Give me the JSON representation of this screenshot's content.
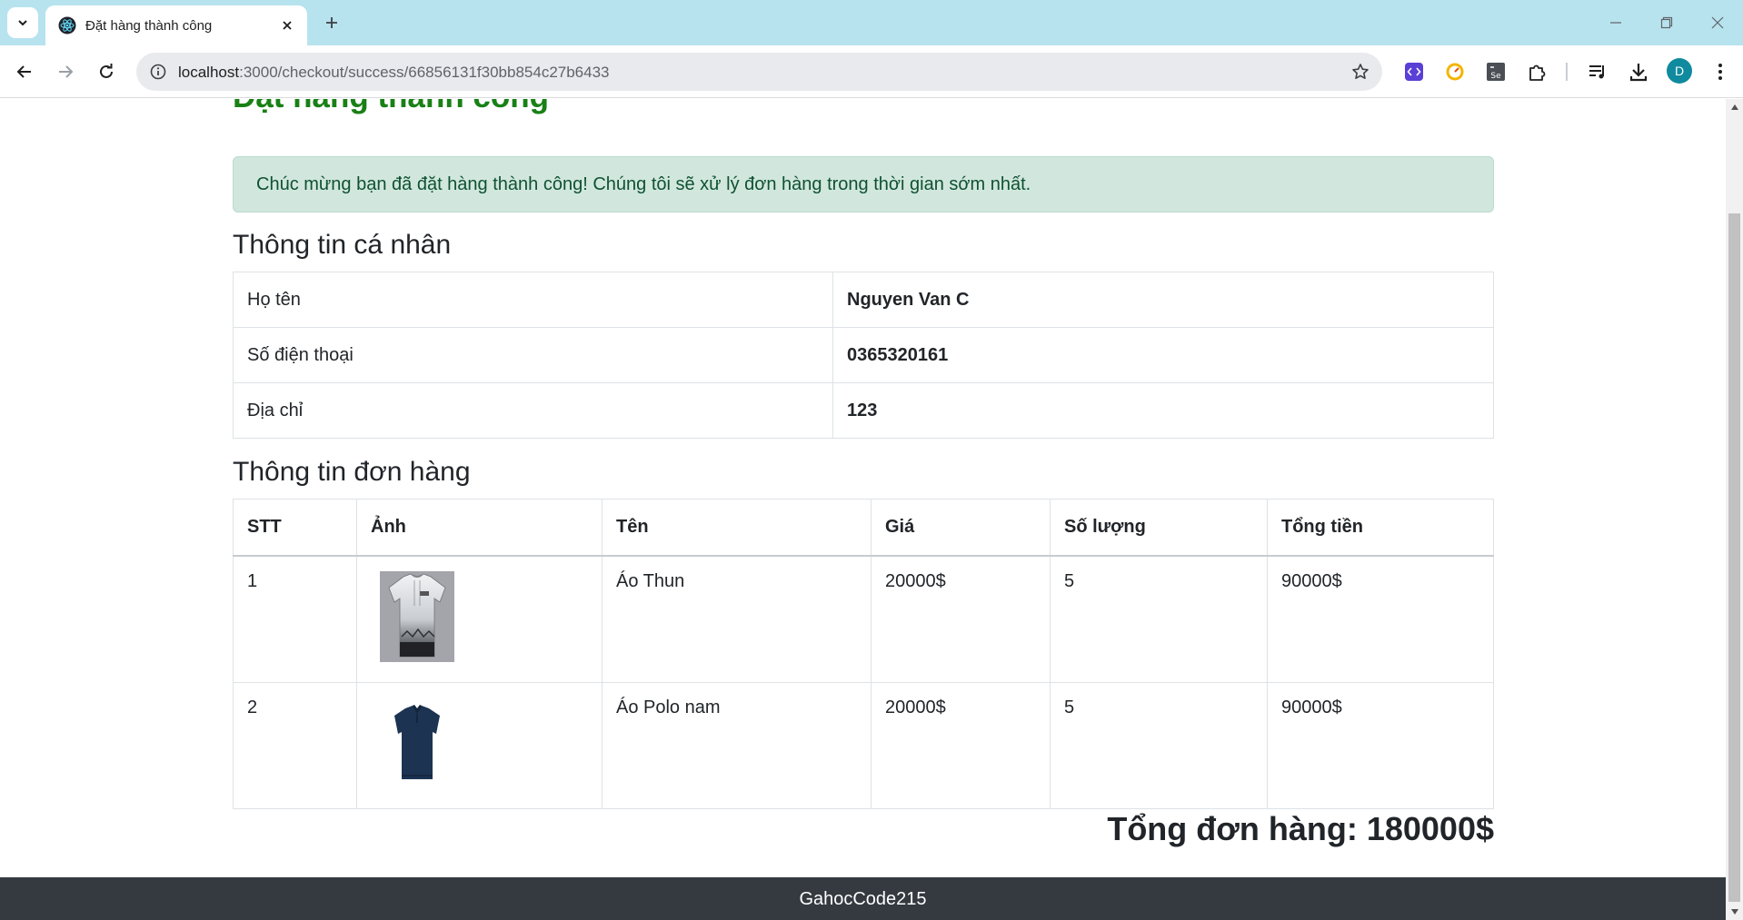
{
  "browser": {
    "tab_title": "Đặt hàng thành công",
    "url_host": "localhost",
    "url_path": ":3000/checkout/success/66856131f30bb854c27b6433",
    "profile_initial": "D"
  },
  "page": {
    "title": "Đặt hàng thành công",
    "alert_message": "Chúc mừng bạn đã đặt hàng thành công! Chúng tôi sẽ xử lý đơn hàng trong thời gian sớm nhất.",
    "personal_section_title": "Thông tin cá nhân",
    "order_section_title": "Thông tin đơn hàng",
    "personal_info": [
      {
        "label": "Họ tên",
        "value": "Nguyen Van C"
      },
      {
        "label": "Số điện thoại",
        "value": "0365320161"
      },
      {
        "label": "Địa chỉ",
        "value": "123"
      }
    ],
    "order_headers": [
      "STT",
      "Ảnh",
      "Tên",
      "Giá",
      "Số lượng",
      "Tổng tiền"
    ],
    "order_items": [
      {
        "stt": "1",
        "image": "white-tshirt-image",
        "name": "Áo Thun",
        "price": "20000$",
        "quantity": "5",
        "total": "90000$"
      },
      {
        "stt": "2",
        "image": "navy-polo-image",
        "name": "Áo Polo nam",
        "price": "20000$",
        "quantity": "5",
        "total": "90000$"
      }
    ],
    "order_total_label": "Tổng đơn hàng: 180000$",
    "footer_text": "GahocCode215"
  },
  "colors": {
    "title_green": "#198016",
    "alert_bg": "#d1e7dd",
    "footer_bg": "#343a40",
    "tabbar_bg": "#b7e3ef"
  }
}
